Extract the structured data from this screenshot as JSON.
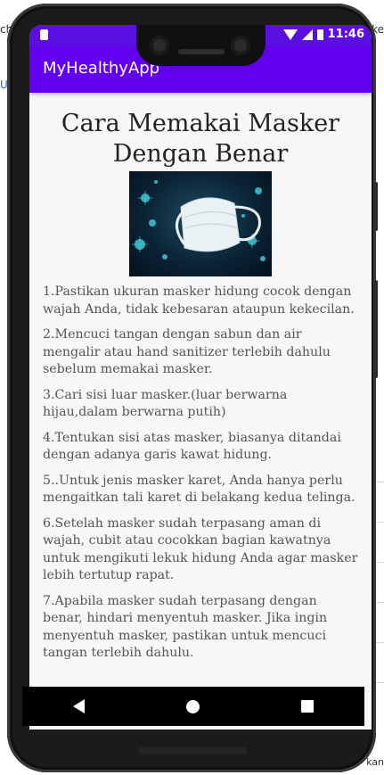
{
  "background": {
    "left_fragment_top": "ch",
    "left_fragment_mid": "U",
    "right_fragment_top": "ke",
    "right_fragment_bottom": "kan"
  },
  "status_bar": {
    "time": "11:46",
    "color": "#5a0fe0"
  },
  "app_bar": {
    "title": "MyHealthyApp",
    "color": "#6200ee"
  },
  "page": {
    "title": "Cara Memakai Masker Dengan Benar",
    "image_alt": "mask-illustration",
    "steps": [
      "1.Pastikan ukuran masker hidung cocok dengan wajah Anda, tidak kebesaran ataupun kekecilan.",
      "2.Mencuci tangan dengan sabun dan air mengalir atau hand sanitizer terlebih dahulu sebelum memakai masker.",
      "3.Cari sisi luar masker.(luar berwarna hijau,dalam berwarna putih)",
      "4.Tentukan sisi atas masker, biasanya ditandai dengan adanya garis kawat hidung.",
      "5..Untuk jenis masker karet, Anda hanya perlu mengaitkan tali karet di belakang kedua telinga.",
      "6.Setelah masker sudah terpasang aman di wajah, cubit atau cocokkan bagian kawatnya untuk mengikuti lekuk hidung Anda agar masker lebih tertutup rapat.",
      "7.Apabila masker sudah terpasang dengan benar, hindari menyentuh masker. Jika ingin menyentuh masker, pastikan untuk mencuci tangan terlebih dahulu."
    ]
  },
  "nav_bar": {
    "icons": [
      "back-icon",
      "home-icon",
      "recent-apps-icon"
    ]
  }
}
